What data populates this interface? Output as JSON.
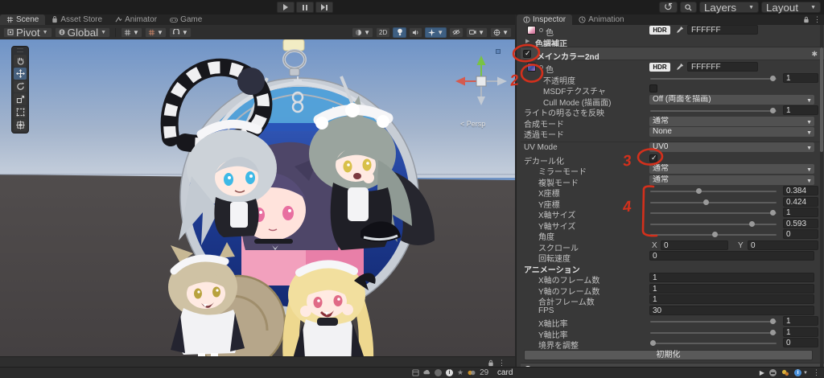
{
  "topbar": {
    "layers_label": "Layers",
    "layout_label": "Layout"
  },
  "left_tabs": [
    {
      "label": "Scene",
      "active": true
    },
    {
      "label": "Asset Store",
      "active": false
    },
    {
      "label": "Animator",
      "active": false
    },
    {
      "label": "Game",
      "active": false
    }
  ],
  "right_tabs": [
    {
      "label": "Inspector",
      "active": true
    },
    {
      "label": "Animation",
      "active": false
    }
  ],
  "scene_toolbar": {
    "pivot_label": "Pivot",
    "global_label": "Global",
    "mode_2d_label": "2D"
  },
  "scene_view": {
    "persp_label": "< Persp"
  },
  "inspector": {
    "top_color_row": {
      "label": "色",
      "hdr": "HDR",
      "hex": "FFFFFF"
    },
    "foldout_label": "色調補正",
    "component_header": {
      "title": "メインカラー2nd",
      "enabled": true
    },
    "rows": [
      {
        "type": "color",
        "ind": 2,
        "label": "色",
        "hdr": "HDR",
        "hex": "FFFFFF",
        "thumb": "blue"
      },
      {
        "type": "slider",
        "ind": 3,
        "label": "不透明度",
        "value": "1",
        "pct": 97
      },
      {
        "type": "check",
        "ind": 3,
        "label": "MSDFテクスチャ",
        "checked": false
      },
      {
        "type": "dropdown",
        "ind": 3,
        "label": "Cull Mode (描画面)",
        "value": "Off (両面を描画)"
      },
      {
        "type": "slider",
        "ind": 1,
        "label": "ライトの明るさを反映",
        "value": "1",
        "pct": 97
      },
      {
        "type": "dropdown",
        "ind": 1,
        "label": "合成モード",
        "value": "通常"
      },
      {
        "type": "dropdown",
        "ind": 1,
        "label": "透過モード",
        "value": "None"
      },
      {
        "type": "dropdown",
        "ind": 1,
        "label": "UV Mode",
        "value": "UV0",
        "sep_before": true
      },
      {
        "type": "check",
        "ind": 1,
        "label": "デカール化",
        "checked": true
      },
      {
        "type": "dropdown",
        "ind": 2,
        "label": "ミラーモード",
        "value": "通常"
      },
      {
        "type": "dropdown",
        "ind": 2,
        "label": "複製モード",
        "value": "通常"
      },
      {
        "type": "slider",
        "ind": 2,
        "label": "X座標",
        "value": "0.384",
        "pct": 38
      },
      {
        "type": "slider",
        "ind": 2,
        "label": "Y座標",
        "value": "0.424",
        "pct": 44
      },
      {
        "type": "slider",
        "ind": 2,
        "label": "X軸サイズ",
        "value": "1",
        "pct": 97
      },
      {
        "type": "slider",
        "ind": 2,
        "label": "Y軸サイズ",
        "value": "0.593",
        "pct": 80
      },
      {
        "type": "slider",
        "ind": 2,
        "label": "角度",
        "value": "0",
        "pct": 51
      },
      {
        "type": "xy",
        "ind": 2,
        "label": "スクロール",
        "x_label": "X",
        "x_value": "0",
        "y_label": "Y",
        "y_value": "0"
      },
      {
        "type": "field",
        "ind": 2,
        "label": "回転速度",
        "value": "0"
      },
      {
        "type": "section",
        "ind": 0,
        "label": "アニメーション"
      },
      {
        "type": "field",
        "ind": 2,
        "label": "X軸のフレーム数",
        "value": "1"
      },
      {
        "type": "field",
        "ind": 2,
        "label": "Y軸のフレーム数",
        "value": "1"
      },
      {
        "type": "field",
        "ind": 2,
        "label": "合計フレーム数",
        "value": "1"
      },
      {
        "type": "field",
        "ind": 2,
        "label": "FPS",
        "value": "30"
      },
      {
        "type": "slider",
        "ind": 2,
        "label": "X軸比率",
        "value": "1",
        "pct": 97
      },
      {
        "type": "slider",
        "ind": 2,
        "label": "Y軸比率",
        "value": "1",
        "pct": 97
      },
      {
        "type": "slider",
        "ind": 2,
        "label": "境界を調整",
        "value": "0",
        "pct": 2
      },
      {
        "type": "button",
        "ind": 0,
        "label": "初期化"
      },
      {
        "type": "component",
        "ind": 0,
        "label": "マスク"
      }
    ]
  },
  "status_bar": {
    "badge_count": "29",
    "selected_item": "card"
  },
  "annotations": {
    "color": "#d3301c",
    "step2": "2",
    "step3": "3",
    "step4": "4"
  },
  "colors": {
    "accent_selected_blue": "#3e5f82",
    "panel_bg": "#383838",
    "header_band": "#464646",
    "dropdown_bg": "#515151",
    "annotation_red": "#d3301c",
    "sky_top": "#7094c6",
    "ground": "#4b4748"
  }
}
